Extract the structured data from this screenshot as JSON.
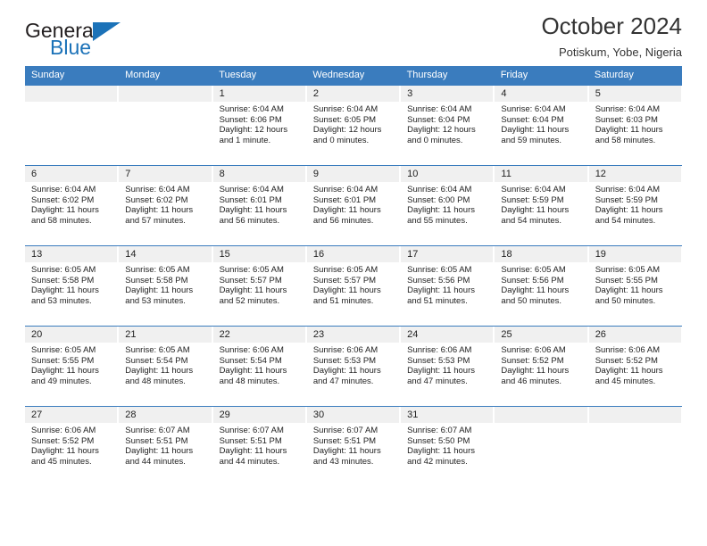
{
  "brand": {
    "name_top": "General",
    "name_bottom": "Blue",
    "accent_color": "#1b72b8"
  },
  "header": {
    "title": "October 2024",
    "subtitle": "Potiskum, Yobe, Nigeria"
  },
  "calendar": {
    "header_color": "#3a7cbe",
    "weekdays": [
      "Sunday",
      "Monday",
      "Tuesday",
      "Wednesday",
      "Thursday",
      "Friday",
      "Saturday"
    ],
    "weeks": [
      [
        {
          "day": "",
          "empty": true
        },
        {
          "day": "",
          "empty": true
        },
        {
          "day": "1",
          "sunrise": "Sunrise: 6:04 AM",
          "sunset": "Sunset: 6:06 PM",
          "daylight": "Daylight: 12 hours and 1 minute."
        },
        {
          "day": "2",
          "sunrise": "Sunrise: 6:04 AM",
          "sunset": "Sunset: 6:05 PM",
          "daylight": "Daylight: 12 hours and 0 minutes."
        },
        {
          "day": "3",
          "sunrise": "Sunrise: 6:04 AM",
          "sunset": "Sunset: 6:04 PM",
          "daylight": "Daylight: 12 hours and 0 minutes."
        },
        {
          "day": "4",
          "sunrise": "Sunrise: 6:04 AM",
          "sunset": "Sunset: 6:04 PM",
          "daylight": "Daylight: 11 hours and 59 minutes."
        },
        {
          "day": "5",
          "sunrise": "Sunrise: 6:04 AM",
          "sunset": "Sunset: 6:03 PM",
          "daylight": "Daylight: 11 hours and 58 minutes."
        }
      ],
      [
        {
          "day": "6",
          "sunrise": "Sunrise: 6:04 AM",
          "sunset": "Sunset: 6:02 PM",
          "daylight": "Daylight: 11 hours and 58 minutes."
        },
        {
          "day": "7",
          "sunrise": "Sunrise: 6:04 AM",
          "sunset": "Sunset: 6:02 PM",
          "daylight": "Daylight: 11 hours and 57 minutes."
        },
        {
          "day": "8",
          "sunrise": "Sunrise: 6:04 AM",
          "sunset": "Sunset: 6:01 PM",
          "daylight": "Daylight: 11 hours and 56 minutes."
        },
        {
          "day": "9",
          "sunrise": "Sunrise: 6:04 AM",
          "sunset": "Sunset: 6:01 PM",
          "daylight": "Daylight: 11 hours and 56 minutes."
        },
        {
          "day": "10",
          "sunrise": "Sunrise: 6:04 AM",
          "sunset": "Sunset: 6:00 PM",
          "daylight": "Daylight: 11 hours and 55 minutes."
        },
        {
          "day": "11",
          "sunrise": "Sunrise: 6:04 AM",
          "sunset": "Sunset: 5:59 PM",
          "daylight": "Daylight: 11 hours and 54 minutes."
        },
        {
          "day": "12",
          "sunrise": "Sunrise: 6:04 AM",
          "sunset": "Sunset: 5:59 PM",
          "daylight": "Daylight: 11 hours and 54 minutes."
        }
      ],
      [
        {
          "day": "13",
          "sunrise": "Sunrise: 6:05 AM",
          "sunset": "Sunset: 5:58 PM",
          "daylight": "Daylight: 11 hours and 53 minutes."
        },
        {
          "day": "14",
          "sunrise": "Sunrise: 6:05 AM",
          "sunset": "Sunset: 5:58 PM",
          "daylight": "Daylight: 11 hours and 53 minutes."
        },
        {
          "day": "15",
          "sunrise": "Sunrise: 6:05 AM",
          "sunset": "Sunset: 5:57 PM",
          "daylight": "Daylight: 11 hours and 52 minutes."
        },
        {
          "day": "16",
          "sunrise": "Sunrise: 6:05 AM",
          "sunset": "Sunset: 5:57 PM",
          "daylight": "Daylight: 11 hours and 51 minutes."
        },
        {
          "day": "17",
          "sunrise": "Sunrise: 6:05 AM",
          "sunset": "Sunset: 5:56 PM",
          "daylight": "Daylight: 11 hours and 51 minutes."
        },
        {
          "day": "18",
          "sunrise": "Sunrise: 6:05 AM",
          "sunset": "Sunset: 5:56 PM",
          "daylight": "Daylight: 11 hours and 50 minutes."
        },
        {
          "day": "19",
          "sunrise": "Sunrise: 6:05 AM",
          "sunset": "Sunset: 5:55 PM",
          "daylight": "Daylight: 11 hours and 50 minutes."
        }
      ],
      [
        {
          "day": "20",
          "sunrise": "Sunrise: 6:05 AM",
          "sunset": "Sunset: 5:55 PM",
          "daylight": "Daylight: 11 hours and 49 minutes."
        },
        {
          "day": "21",
          "sunrise": "Sunrise: 6:05 AM",
          "sunset": "Sunset: 5:54 PM",
          "daylight": "Daylight: 11 hours and 48 minutes."
        },
        {
          "day": "22",
          "sunrise": "Sunrise: 6:06 AM",
          "sunset": "Sunset: 5:54 PM",
          "daylight": "Daylight: 11 hours and 48 minutes."
        },
        {
          "day": "23",
          "sunrise": "Sunrise: 6:06 AM",
          "sunset": "Sunset: 5:53 PM",
          "daylight": "Daylight: 11 hours and 47 minutes."
        },
        {
          "day": "24",
          "sunrise": "Sunrise: 6:06 AM",
          "sunset": "Sunset: 5:53 PM",
          "daylight": "Daylight: 11 hours and 47 minutes."
        },
        {
          "day": "25",
          "sunrise": "Sunrise: 6:06 AM",
          "sunset": "Sunset: 5:52 PM",
          "daylight": "Daylight: 11 hours and 46 minutes."
        },
        {
          "day": "26",
          "sunrise": "Sunrise: 6:06 AM",
          "sunset": "Sunset: 5:52 PM",
          "daylight": "Daylight: 11 hours and 45 minutes."
        }
      ],
      [
        {
          "day": "27",
          "sunrise": "Sunrise: 6:06 AM",
          "sunset": "Sunset: 5:52 PM",
          "daylight": "Daylight: 11 hours and 45 minutes."
        },
        {
          "day": "28",
          "sunrise": "Sunrise: 6:07 AM",
          "sunset": "Sunset: 5:51 PM",
          "daylight": "Daylight: 11 hours and 44 minutes."
        },
        {
          "day": "29",
          "sunrise": "Sunrise: 6:07 AM",
          "sunset": "Sunset: 5:51 PM",
          "daylight": "Daylight: 11 hours and 44 minutes."
        },
        {
          "day": "30",
          "sunrise": "Sunrise: 6:07 AM",
          "sunset": "Sunset: 5:51 PM",
          "daylight": "Daylight: 11 hours and 43 minutes."
        },
        {
          "day": "31",
          "sunrise": "Sunrise: 6:07 AM",
          "sunset": "Sunset: 5:50 PM",
          "daylight": "Daylight: 11 hours and 42 minutes."
        },
        {
          "day": "",
          "empty": true
        },
        {
          "day": "",
          "empty": true
        }
      ]
    ]
  }
}
